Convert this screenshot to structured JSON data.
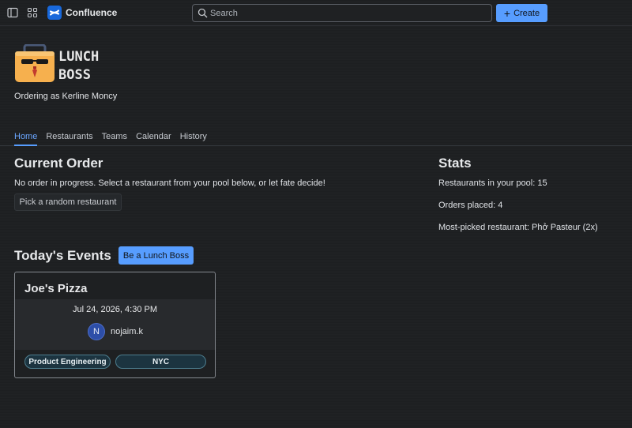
{
  "topbar": {
    "brand": "Confluence",
    "search_placeholder": "Search",
    "create_label": "Create"
  },
  "app": {
    "logo_line1": "LUNCH",
    "logo_line2": "BOSS",
    "ordering_as": "Ordering as Kerline Moncy"
  },
  "tabs": [
    {
      "label": "Home",
      "active": true
    },
    {
      "label": "Restaurants",
      "active": false
    },
    {
      "label": "Teams",
      "active": false
    },
    {
      "label": "Calendar",
      "active": false
    },
    {
      "label": "History",
      "active": false
    }
  ],
  "current_order": {
    "heading": "Current Order",
    "message": "No order in progress. Select a restaurant from your pool below, or let fate decide!",
    "random_button": "Pick a random restaurant"
  },
  "stats": {
    "heading": "Stats",
    "pool": "Restaurants in your pool: 15",
    "orders": "Orders placed: 4",
    "most_picked": "Most-picked restaurant: Phở Pasteur (2x)"
  },
  "events": {
    "heading": "Today's Events",
    "be_boss_button": "Be a Lunch Boss",
    "card": {
      "restaurant": "Joe's Pizza",
      "datetime": "Jul 24, 2026, 4:30 PM",
      "avatar_initial": "N",
      "username": "nojaim.k",
      "tags": [
        "Product Engineering",
        "NYC"
      ]
    }
  },
  "colors": {
    "accent": "#579dff",
    "background": "#1d1f21",
    "tag_bg": "#1c3440"
  }
}
